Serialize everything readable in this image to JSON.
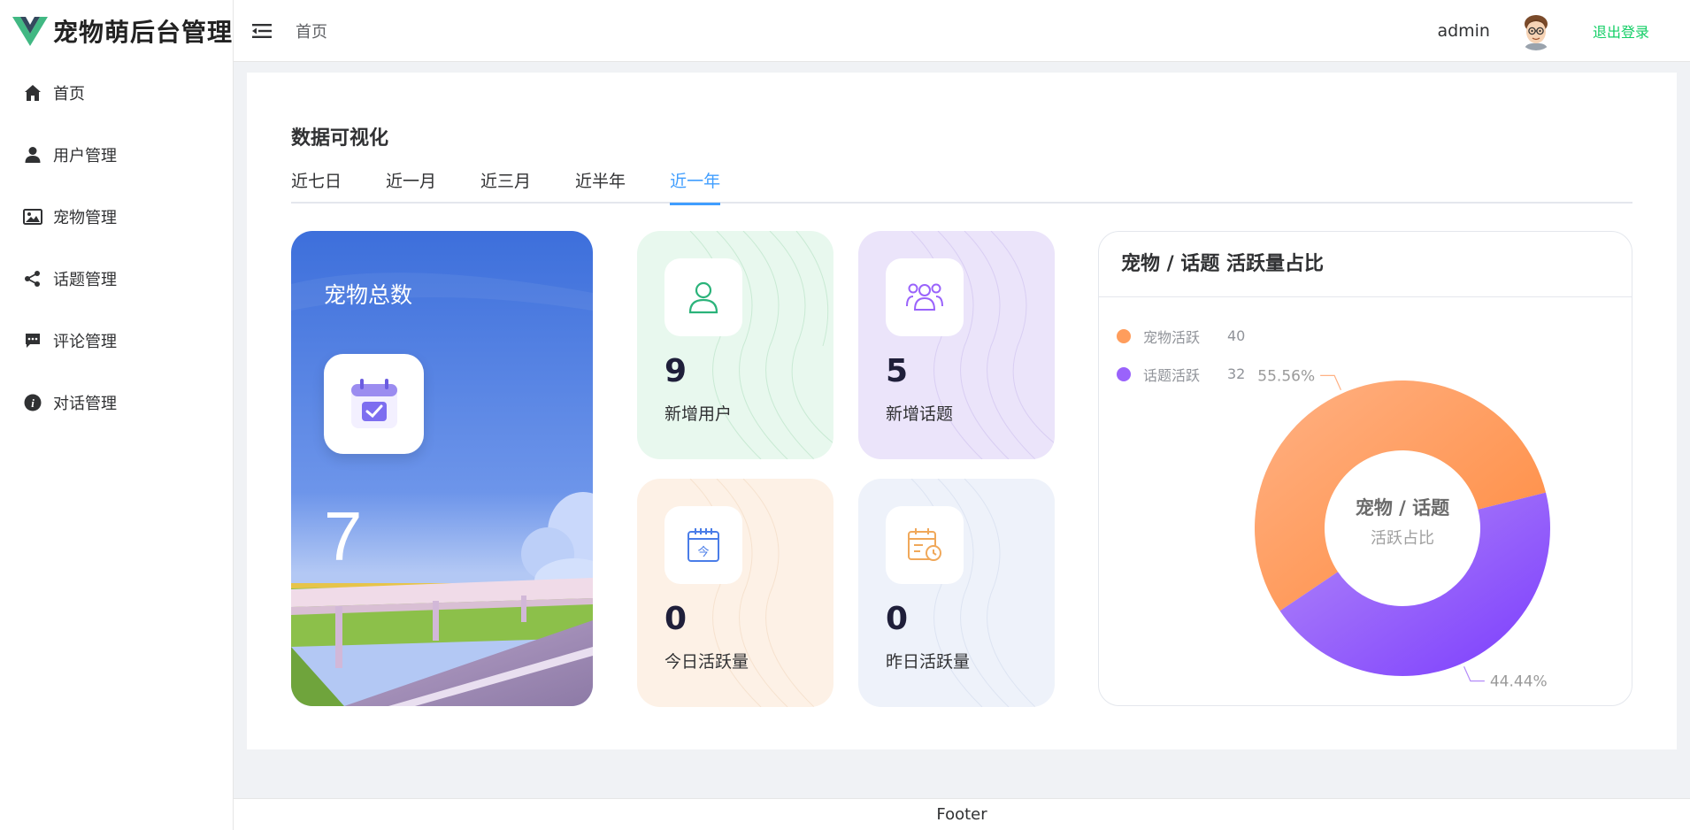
{
  "app": {
    "title": "宠物萌后台管理"
  },
  "sidebar": {
    "items": [
      {
        "label": "首页",
        "icon": "home-icon"
      },
      {
        "label": "用户管理",
        "icon": "user-icon"
      },
      {
        "label": "宠物管理",
        "icon": "image-icon"
      },
      {
        "label": "话题管理",
        "icon": "share-icon"
      },
      {
        "label": "评论管理",
        "icon": "comment-icon"
      },
      {
        "label": "对话管理",
        "icon": "info-icon"
      }
    ]
  },
  "header": {
    "breadcrumb": "首页",
    "username": "admin",
    "logout_label": "退出登录"
  },
  "dashboard": {
    "section_title": "数据可视化",
    "tabs": [
      "近七日",
      "近一月",
      "近三月",
      "近半年",
      "近一年"
    ],
    "active_tab": "近一年",
    "total_card": {
      "title": "宠物总数",
      "value": "7"
    },
    "stats": [
      {
        "value": "9",
        "label": "新增用户",
        "icon": "user-outline-icon",
        "bg": "#e8f8ee"
      },
      {
        "value": "5",
        "label": "新增话题",
        "icon": "group-icon",
        "bg": "#ebe4fa"
      },
      {
        "value": "0",
        "label": "今日活跃量",
        "icon": "calendar-today-icon",
        "bg": "#fdf1e6"
      },
      {
        "value": "0",
        "label": "昨日活跃量",
        "icon": "calendar-clock-icon",
        "bg": "#eef2fa"
      }
    ]
  },
  "pie": {
    "title": "宠物 / 话题 活跃量占比",
    "center_title": "宠物 / 话题",
    "center_subtitle": "活跃占比",
    "legend": [
      {
        "name": "宠物活跃",
        "value": "40",
        "color": "#ff9d5c"
      },
      {
        "name": "话题活跃",
        "value": "32",
        "color": "#9a63fb"
      }
    ],
    "labels": [
      "55.56%",
      "44.44%"
    ]
  },
  "chart_data": {
    "type": "pie",
    "title": "宠物 / 话题 活跃量占比",
    "categories": [
      "宠物活跃",
      "话题活跃"
    ],
    "values": [
      40,
      32
    ],
    "percent_labels": [
      "55.56%",
      "44.44%"
    ],
    "donut": true,
    "legend": "top-left"
  },
  "footer": {
    "text": "Footer"
  }
}
